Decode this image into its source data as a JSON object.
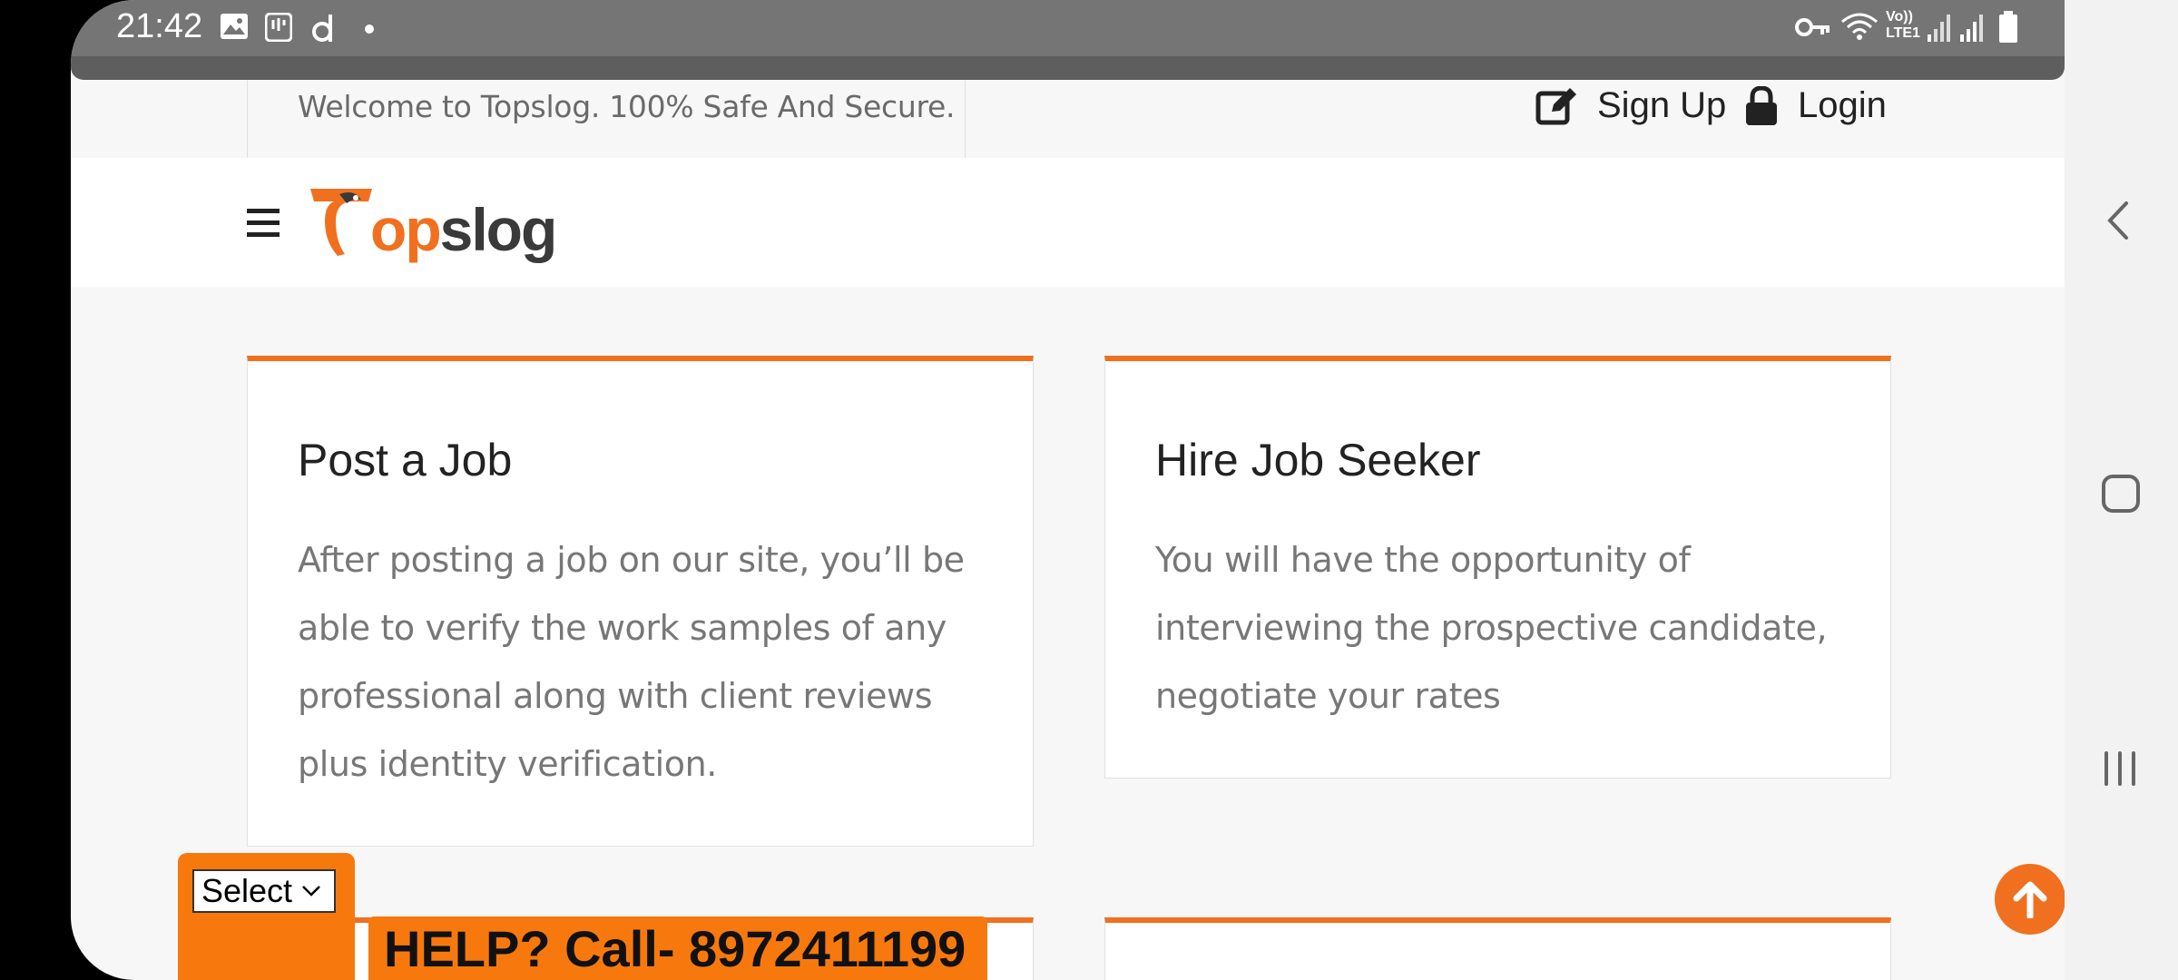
{
  "status_bar": {
    "time": "21:42",
    "icons": [
      "gallery-icon",
      "app-notification-icon",
      "app-d-icon",
      "dot-icon",
      "vpn-key-icon",
      "wifi-icon",
      "volte-lte1-icon",
      "signal-1-icon",
      "signal-2-icon",
      "battery-icon"
    ],
    "network_label_top": "Vo))",
    "network_label_bottom": "LTE1"
  },
  "topbar": {
    "welcome": "Welcome to Topslog. 100% Safe And Secure.",
    "signup_label": "Sign Up",
    "login_label": "Login"
  },
  "header": {
    "logo_initial": "T",
    "logo_op": "op",
    "logo_slog": "slog"
  },
  "cards": [
    {
      "title": "Post a Job",
      "body": "After posting a job on our site, you’ll be able to verify the work samples of any professional along with client reviews plus identity verification."
    },
    {
      "title": "Hire Job Seeker",
      "body": "You will have the opportunity of interviewing the prospective candidate, negotiate your rates"
    }
  ],
  "language_select": {
    "value": "Select"
  },
  "help_banner": "HELP? Call- 8972411199",
  "colors": {
    "accent": "#f07020",
    "banner": "#f7790d",
    "status_bar": "#757575"
  },
  "nav_buttons": [
    "back-icon",
    "home-icon",
    "recents-icon"
  ]
}
